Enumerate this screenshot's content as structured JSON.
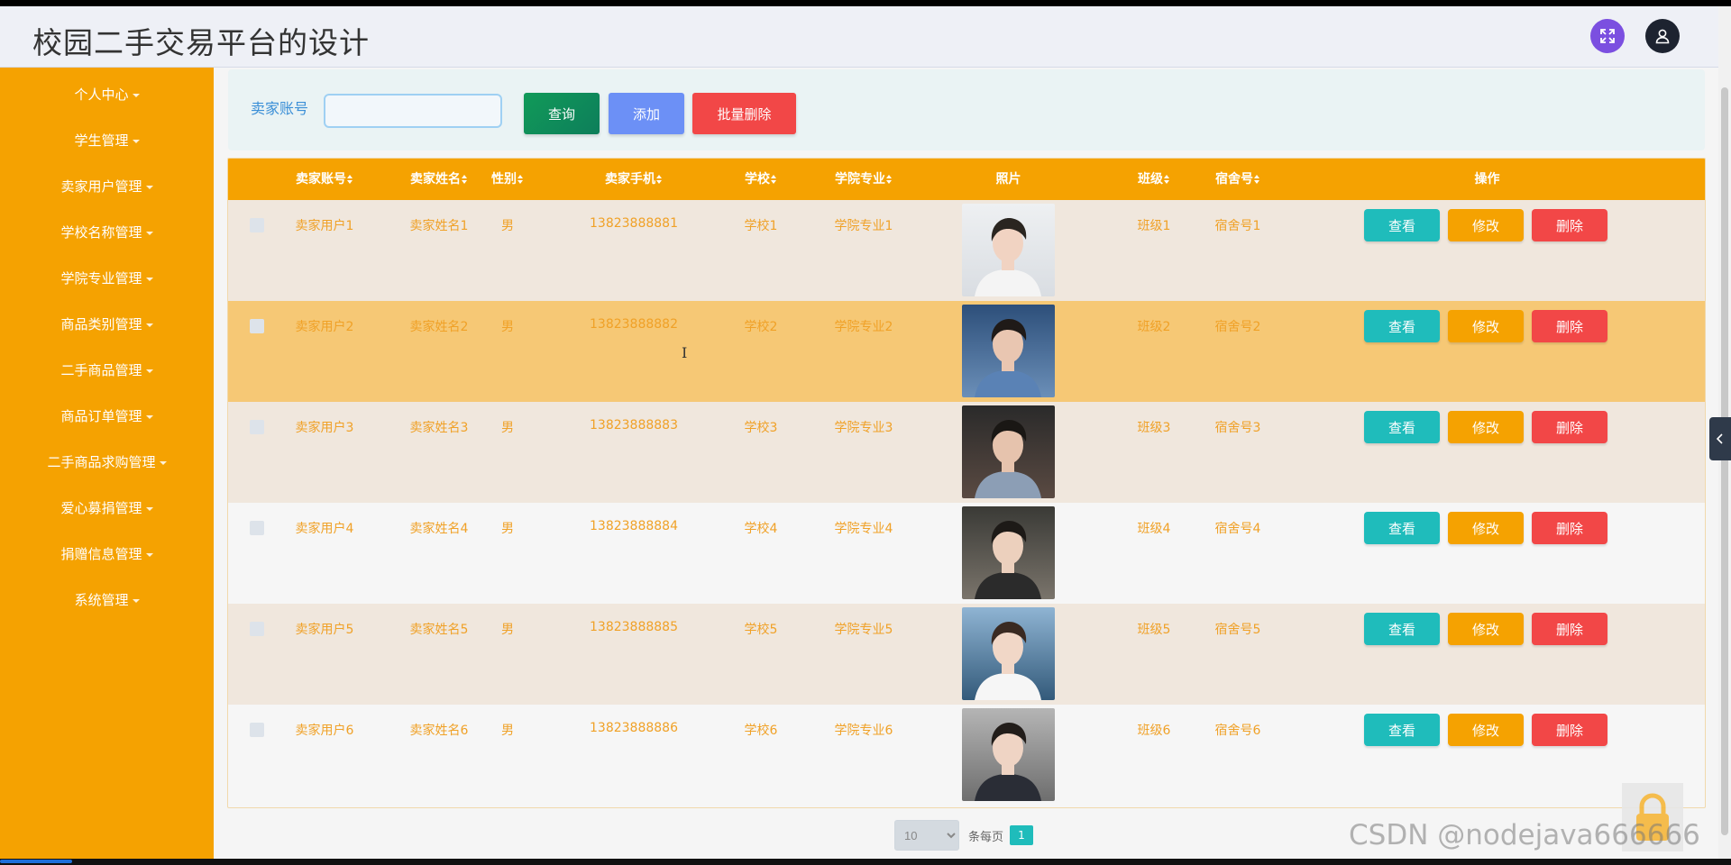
{
  "app": {
    "title": "校园二手交易平台的设计"
  },
  "header": {
    "fullscreen_icon": "expand-icon",
    "user_icon": "user-icon"
  },
  "sidebar": {
    "items": [
      {
        "label": "个人中心"
      },
      {
        "label": "学生管理"
      },
      {
        "label": "卖家用户管理"
      },
      {
        "label": "学校名称管理"
      },
      {
        "label": "学院专业管理"
      },
      {
        "label": "商品类别管理"
      },
      {
        "label": "二手商品管理"
      },
      {
        "label": "商品订单管理"
      },
      {
        "label": "二手商品求购管理"
      },
      {
        "label": "爱心募捐管理"
      },
      {
        "label": "捐赠信息管理"
      },
      {
        "label": "系统管理"
      }
    ]
  },
  "search": {
    "label": "卖家账号",
    "value": "",
    "query_label": "查询",
    "add_label": "添加",
    "bulk_delete_label": "批量删除"
  },
  "table": {
    "columns": [
      "卖家账号",
      "卖家姓名",
      "性别",
      "卖家手机",
      "学校",
      "学院专业",
      "照片",
      "班级",
      "宿舍号",
      "操作"
    ],
    "rows": [
      {
        "account": "卖家用户1",
        "name": "卖家姓名1",
        "gender": "男",
        "phone": "13823888881",
        "school": "学校1",
        "major": "学院专业1",
        "class": "班级1",
        "dorm": "宿舍号1"
      },
      {
        "account": "卖家用户2",
        "name": "卖家姓名2",
        "gender": "男",
        "phone": "13823888882",
        "school": "学校2",
        "major": "学院专业2",
        "class": "班级2",
        "dorm": "宿舍号2"
      },
      {
        "account": "卖家用户3",
        "name": "卖家姓名3",
        "gender": "男",
        "phone": "13823888883",
        "school": "学校3",
        "major": "学院专业3",
        "class": "班级3",
        "dorm": "宿舍号3"
      },
      {
        "account": "卖家用户4",
        "name": "卖家姓名4",
        "gender": "男",
        "phone": "13823888884",
        "school": "学校4",
        "major": "学院专业4",
        "class": "班级4",
        "dorm": "宿舍号4"
      },
      {
        "account": "卖家用户5",
        "name": "卖家姓名5",
        "gender": "男",
        "phone": "13823888885",
        "school": "学校5",
        "major": "学院专业5",
        "class": "班级5",
        "dorm": "宿舍号5"
      },
      {
        "account": "卖家用户6",
        "name": "卖家姓名6",
        "gender": "男",
        "phone": "13823888886",
        "school": "学校6",
        "major": "学院专业6",
        "class": "班级6",
        "dorm": "宿舍号6"
      }
    ],
    "actions": {
      "view": "查看",
      "edit": "修改",
      "delete": "删除"
    }
  },
  "pagination": {
    "page_size": "10",
    "per_page_label": "条每页",
    "current_page": "1"
  },
  "watermark": "CSDN @nodejava666666",
  "colors": {
    "sidebar": "#f5a201",
    "table_header": "#f5a201",
    "text_accent": "#f0a127",
    "view_button": "#1fbcbb",
    "edit_button": "#f5a201",
    "delete_button": "#f24747",
    "add_button": "#6c90f6",
    "query_button": "#119a59",
    "row_a": "#f0e7dd",
    "row_b": "#f6c875",
    "row_c": "#f6f6f6"
  }
}
